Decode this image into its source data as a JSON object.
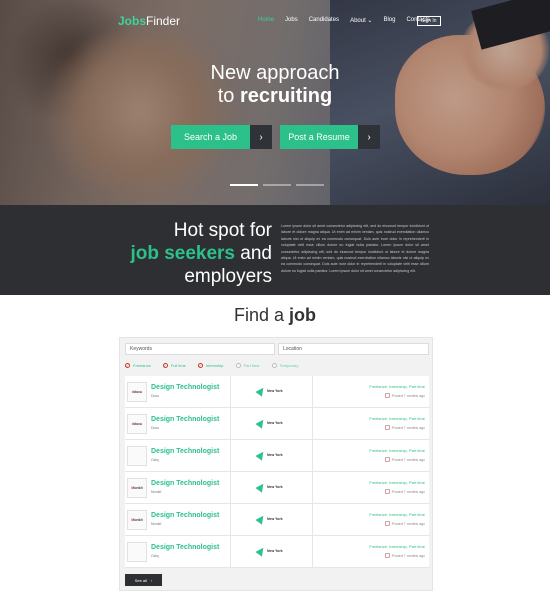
{
  "header": {
    "logo_bold": "Jobs",
    "logo_rest": "Finder",
    "nav": [
      {
        "label": "Home",
        "active": true
      },
      {
        "label": "Jobs",
        "active": false
      },
      {
        "label": "Candidates",
        "active": false
      },
      {
        "label": "About ⌄",
        "active": false
      },
      {
        "label": "Blog",
        "active": false
      },
      {
        "label": "Contacts",
        "active": false
      }
    ],
    "signin_label": "Sign In"
  },
  "hero": {
    "line1": "New approach",
    "line2_prefix": "to ",
    "line2_strong": "recruiting",
    "search_button": "Search a Job",
    "post_button": "Post a Resume",
    "arrow": "›"
  },
  "band": {
    "line1": "Hot spot for",
    "line2_green": "job seekers",
    "line2_rest": " and",
    "line3": "employers",
    "paragraph": "Lorem ipsum dolor sit amet consectetur adipiscing elit, sed do eiusmod tempor incididunt ut labore et dolore magna aliqua. Ut enim ad minim veniam, quis nostrud exercitation ullamco laboris nisi ut aliquip ex ea commodo consequat. Duis aute irure dolor in reprehenderit in voluptate velit esse cillum dolore eu fugiat nulla pariatur. Lorem ipsum dolor sit amet consectetur adipiscing elit, sed do eiusmod tempor incididunt ut labore et dolore magna aliqua. Ut enim ad minim veniam, quis nostrud exercitation ullamco laboris nisi ut aliquip ex ea commodo consequat. Duis aute irure dolor in reprehenderit in voluptate velit esse cillum dolore eu fugiat nulla pariatur. Lorem ipsum dolor sit amet consectetur adipiscing elit."
  },
  "find": {
    "title_prefix": "Find a ",
    "title_strong": "job",
    "keywords_placeholder": "Keywords",
    "location_placeholder": "Location",
    "filters": [
      {
        "label": "Freelance",
        "checked": true
      },
      {
        "label": "Full time",
        "checked": true
      },
      {
        "label": "Internship",
        "checked": true
      },
      {
        "label": "Part time",
        "checked": false
      },
      {
        "label": "Temporary",
        "checked": false
      }
    ],
    "jobs": [
      {
        "title": "Design Technologist",
        "company": "Docu",
        "logo": "docu",
        "place": "New York",
        "types": "Freelance, Internship, Part time",
        "posted": "Posted 7 months ago"
      },
      {
        "title": "Design Technologist",
        "company": "Docu",
        "logo": "docu",
        "place": "New York",
        "types": "Freelance, Internship, Part time",
        "posted": "Posted 7 months ago"
      },
      {
        "title": "Design Technologist",
        "company": "Ozky",
        "logo": "",
        "place": "New York",
        "types": "Freelance, Internship, Part time",
        "posted": "Posted 7 months ago"
      },
      {
        "title": "Design Technologist",
        "company": "Monkit",
        "logo": "monkit",
        "place": "New York",
        "types": "Freelance, Internship, Part time",
        "posted": "Posted 7 months ago"
      },
      {
        "title": "Design Technologist",
        "company": "Monkit",
        "logo": "monkit",
        "place": "New York",
        "types": "Freelance, Internship, Part time",
        "posted": "Posted 7 months ago"
      },
      {
        "title": "Design Technologist",
        "company": "Ozky",
        "logo": "",
        "place": "New York",
        "types": "Freelance, Internship, Part time",
        "posted": "Posted 7 months ago"
      }
    ],
    "see_all": "See all",
    "see_all_arrow": "›"
  },
  "colors": {
    "accent": "#2cc08a",
    "dark": "#2d2f32"
  }
}
